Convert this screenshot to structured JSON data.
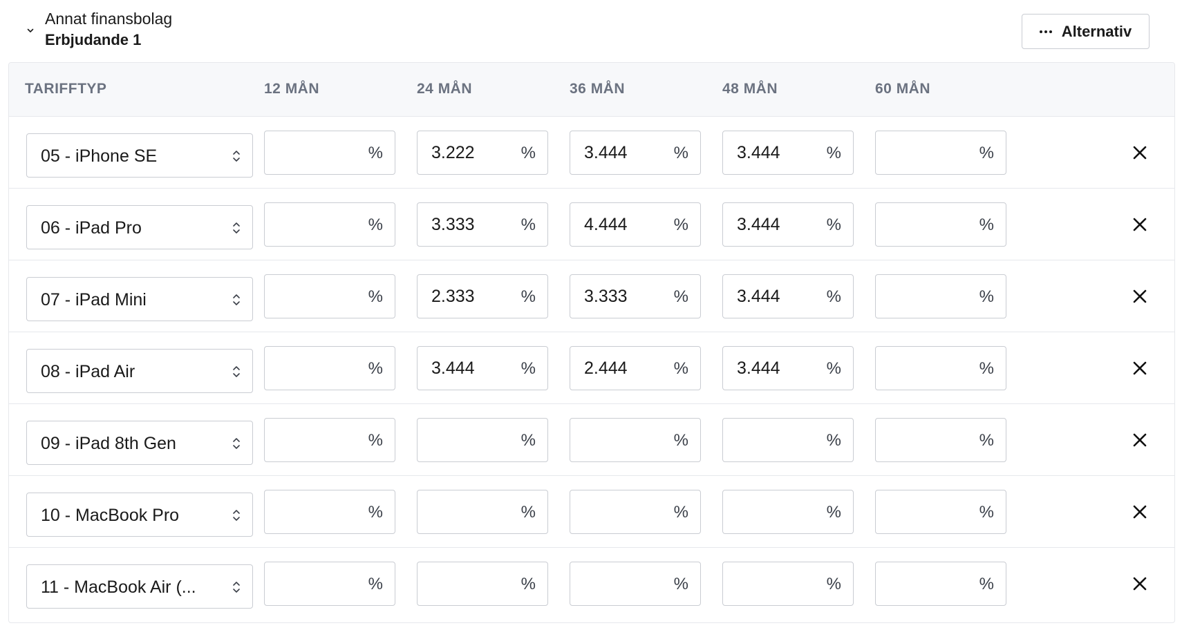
{
  "header": {
    "org_name": "Annat finansbolag",
    "offer_name": "Erbjudande 1",
    "options_label": "Alternativ"
  },
  "table": {
    "columns": [
      "TARIFFTYP",
      "12 MÅN",
      "24 MÅN",
      "36 MÅN",
      "48 MÅN",
      "60 MÅN"
    ],
    "unit": "%",
    "rows": [
      {
        "tariff": "05 - iPhone SE",
        "rates": [
          "",
          "3.222",
          "3.444",
          "3.444",
          ""
        ]
      },
      {
        "tariff": "06 - iPad Pro",
        "rates": [
          "",
          "3.333",
          "4.444",
          "3.444",
          ""
        ]
      },
      {
        "tariff": "07 - iPad Mini",
        "rates": [
          "",
          "2.333",
          "3.333",
          "3.444",
          ""
        ]
      },
      {
        "tariff": "08 - iPad Air",
        "rates": [
          "",
          "3.444",
          "2.444",
          "3.444",
          ""
        ]
      },
      {
        "tariff": "09 - iPad 8th Gen",
        "rates": [
          "",
          "",
          "",
          "",
          ""
        ]
      },
      {
        "tariff": "10 - MacBook Pro",
        "rates": [
          "",
          "",
          "",
          "",
          ""
        ]
      },
      {
        "tariff": "11 - MacBook Air (...",
        "rates": [
          "",
          "",
          "",
          "",
          ""
        ]
      }
    ]
  },
  "icons": {
    "collapse": "chevron-down-icon",
    "options": "more-horizontal-icon",
    "select": "chevron-up-down-icon",
    "remove": "close-icon"
  },
  "colors": {
    "border": "#c9ccd2",
    "header_bg": "#f7f8fa",
    "header_text": "#6b7280",
    "text": "#1a1a1a"
  }
}
